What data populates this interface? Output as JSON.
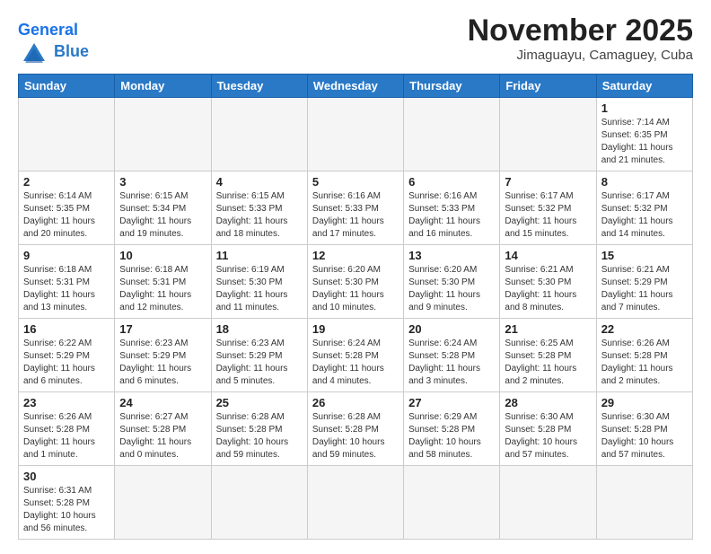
{
  "header": {
    "logo_general": "General",
    "logo_blue": "Blue",
    "month": "November 2025",
    "location": "Jimaguayu, Camaguey, Cuba"
  },
  "days_of_week": [
    "Sunday",
    "Monday",
    "Tuesday",
    "Wednesday",
    "Thursday",
    "Friday",
    "Saturday"
  ],
  "weeks": [
    [
      {
        "day": "",
        "info": ""
      },
      {
        "day": "",
        "info": ""
      },
      {
        "day": "",
        "info": ""
      },
      {
        "day": "",
        "info": ""
      },
      {
        "day": "",
        "info": ""
      },
      {
        "day": "",
        "info": ""
      },
      {
        "day": "1",
        "info": "Sunrise: 7:14 AM\nSunset: 6:35 PM\nDaylight: 11 hours and 21 minutes."
      }
    ],
    [
      {
        "day": "2",
        "info": "Sunrise: 6:14 AM\nSunset: 5:35 PM\nDaylight: 11 hours and 20 minutes."
      },
      {
        "day": "3",
        "info": "Sunrise: 6:15 AM\nSunset: 5:34 PM\nDaylight: 11 hours and 19 minutes."
      },
      {
        "day": "4",
        "info": "Sunrise: 6:15 AM\nSunset: 5:33 PM\nDaylight: 11 hours and 18 minutes."
      },
      {
        "day": "5",
        "info": "Sunrise: 6:16 AM\nSunset: 5:33 PM\nDaylight: 11 hours and 17 minutes."
      },
      {
        "day": "6",
        "info": "Sunrise: 6:16 AM\nSunset: 5:33 PM\nDaylight: 11 hours and 16 minutes."
      },
      {
        "day": "7",
        "info": "Sunrise: 6:17 AM\nSunset: 5:32 PM\nDaylight: 11 hours and 15 minutes."
      },
      {
        "day": "8",
        "info": "Sunrise: 6:17 AM\nSunset: 5:32 PM\nDaylight: 11 hours and 14 minutes."
      }
    ],
    [
      {
        "day": "9",
        "info": "Sunrise: 6:18 AM\nSunset: 5:31 PM\nDaylight: 11 hours and 13 minutes."
      },
      {
        "day": "10",
        "info": "Sunrise: 6:18 AM\nSunset: 5:31 PM\nDaylight: 11 hours and 12 minutes."
      },
      {
        "day": "11",
        "info": "Sunrise: 6:19 AM\nSunset: 5:30 PM\nDaylight: 11 hours and 11 minutes."
      },
      {
        "day": "12",
        "info": "Sunrise: 6:20 AM\nSunset: 5:30 PM\nDaylight: 11 hours and 10 minutes."
      },
      {
        "day": "13",
        "info": "Sunrise: 6:20 AM\nSunset: 5:30 PM\nDaylight: 11 hours and 9 minutes."
      },
      {
        "day": "14",
        "info": "Sunrise: 6:21 AM\nSunset: 5:30 PM\nDaylight: 11 hours and 8 minutes."
      },
      {
        "day": "15",
        "info": "Sunrise: 6:21 AM\nSunset: 5:29 PM\nDaylight: 11 hours and 7 minutes."
      }
    ],
    [
      {
        "day": "16",
        "info": "Sunrise: 6:22 AM\nSunset: 5:29 PM\nDaylight: 11 hours and 6 minutes."
      },
      {
        "day": "17",
        "info": "Sunrise: 6:23 AM\nSunset: 5:29 PM\nDaylight: 11 hours and 6 minutes."
      },
      {
        "day": "18",
        "info": "Sunrise: 6:23 AM\nSunset: 5:29 PM\nDaylight: 11 hours and 5 minutes."
      },
      {
        "day": "19",
        "info": "Sunrise: 6:24 AM\nSunset: 5:28 PM\nDaylight: 11 hours and 4 minutes."
      },
      {
        "day": "20",
        "info": "Sunrise: 6:24 AM\nSunset: 5:28 PM\nDaylight: 11 hours and 3 minutes."
      },
      {
        "day": "21",
        "info": "Sunrise: 6:25 AM\nSunset: 5:28 PM\nDaylight: 11 hours and 2 minutes."
      },
      {
        "day": "22",
        "info": "Sunrise: 6:26 AM\nSunset: 5:28 PM\nDaylight: 11 hours and 2 minutes."
      }
    ],
    [
      {
        "day": "23",
        "info": "Sunrise: 6:26 AM\nSunset: 5:28 PM\nDaylight: 11 hours and 1 minute."
      },
      {
        "day": "24",
        "info": "Sunrise: 6:27 AM\nSunset: 5:28 PM\nDaylight: 11 hours and 0 minutes."
      },
      {
        "day": "25",
        "info": "Sunrise: 6:28 AM\nSunset: 5:28 PM\nDaylight: 10 hours and 59 minutes."
      },
      {
        "day": "26",
        "info": "Sunrise: 6:28 AM\nSunset: 5:28 PM\nDaylight: 10 hours and 59 minutes."
      },
      {
        "day": "27",
        "info": "Sunrise: 6:29 AM\nSunset: 5:28 PM\nDaylight: 10 hours and 58 minutes."
      },
      {
        "day": "28",
        "info": "Sunrise: 6:30 AM\nSunset: 5:28 PM\nDaylight: 10 hours and 57 minutes."
      },
      {
        "day": "29",
        "info": "Sunrise: 6:30 AM\nSunset: 5:28 PM\nDaylight: 10 hours and 57 minutes."
      }
    ],
    [
      {
        "day": "30",
        "info": "Sunrise: 6:31 AM\nSunset: 5:28 PM\nDaylight: 10 hours and 56 minutes."
      },
      {
        "day": "",
        "info": ""
      },
      {
        "day": "",
        "info": ""
      },
      {
        "day": "",
        "info": ""
      },
      {
        "day": "",
        "info": ""
      },
      {
        "day": "",
        "info": ""
      },
      {
        "day": "",
        "info": ""
      }
    ]
  ]
}
